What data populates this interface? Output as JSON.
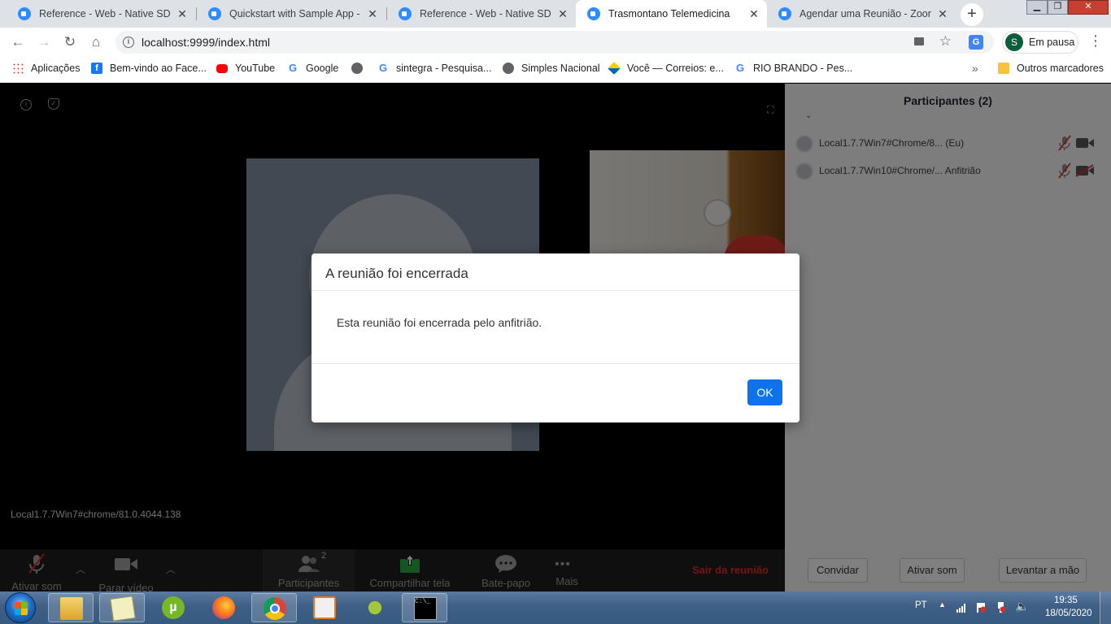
{
  "browser": {
    "tabs": [
      {
        "title": "Reference - Web - Native SDKs",
        "active": false
      },
      {
        "title": "Quickstart with Sample App - G",
        "active": false
      },
      {
        "title": "Reference - Web - Native SDKs",
        "active": false
      },
      {
        "title": "Trasmontano Telemedicina",
        "active": true
      },
      {
        "title": "Agendar uma Reunião - Zoom",
        "active": false
      }
    ],
    "tab_close_glyph": "✕",
    "new_tab_glyph": "+",
    "url": "localhost:9999/index.html",
    "profile_initial": "S",
    "profile_label": "Em pausa",
    "bookmarks": [
      {
        "label": "Aplicações",
        "icon": "apps-grid-icon"
      },
      {
        "label": "Bem-vindo ao Face...",
        "icon": "facebook-icon"
      },
      {
        "label": "YouTube",
        "icon": "youtube-icon"
      },
      {
        "label": "Google",
        "icon": "google-icon"
      },
      {
        "label": "",
        "icon": "globe-icon"
      },
      {
        "label": "sintegra - Pesquisa...",
        "icon": "google-icon"
      },
      {
        "label": "Simples Nacional",
        "icon": "globe-icon"
      },
      {
        "label": "Você — Correios: e...",
        "icon": "correios-icon"
      },
      {
        "label": "RIO BRANDO - Pes...",
        "icon": "google-icon"
      }
    ],
    "other_bookmarks": "Outros marcadores"
  },
  "zoom": {
    "self_name": "Local1.7.7Win7#chrome/81.0.4044.138",
    "participants_panel": {
      "title": "Participantes (2)",
      "participants": [
        {
          "name": "Local1.7.7Win7#Chrome/8... (Eu)",
          "mic": "muted",
          "video": "on"
        },
        {
          "name": "Local1.7.7Win10#Chrome/... Anfitrião",
          "mic": "muted",
          "video": "off"
        }
      ],
      "buttons": {
        "invite": "Convidar",
        "unmute": "Ativar som",
        "raise_hand": "Levantar a mão"
      }
    },
    "footer": {
      "unmute": "Ativar som",
      "stop_video": "Parar vídeo",
      "participants": "Participantes",
      "participants_count": "2",
      "share_screen": "Compartilhar tela",
      "chat": "Bate-papo",
      "more": "Mais",
      "leave": "Sair da reunião"
    }
  },
  "dialog": {
    "title": "A reunião foi encerrada",
    "message": "Esta reunião foi encerrada pelo anfitrião.",
    "ok": "OK"
  },
  "taskbar": {
    "language": "PT",
    "time": "19:35",
    "date": "18/05/2020"
  },
  "colors": {
    "zoom_blue": "#0e72ed",
    "leave_red": "#e02828",
    "share_green": "#26a641"
  }
}
